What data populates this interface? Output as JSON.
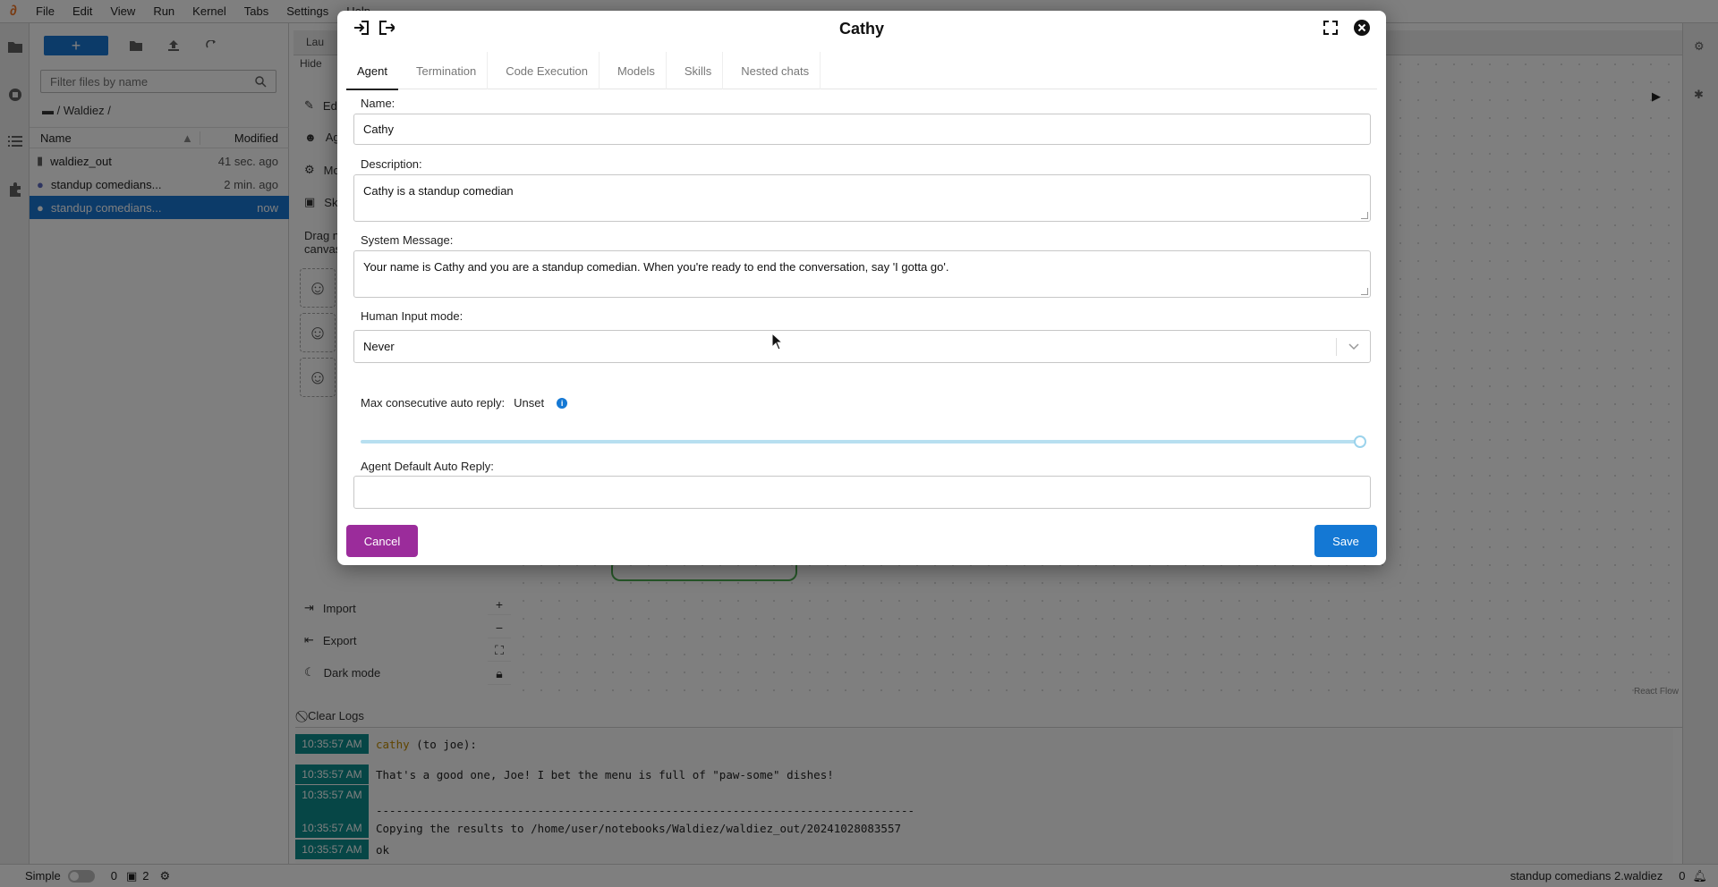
{
  "menubar": {
    "items": [
      "File",
      "Edit",
      "View",
      "Run",
      "Kernel",
      "Tabs",
      "Settings",
      "Help"
    ]
  },
  "filebrowser": {
    "filter_placeholder": "Filter files by name",
    "breadcrumb": "/ Waldiez /",
    "col_name": "Name",
    "col_modified": "Modified",
    "files": [
      {
        "name": "waldiez_out",
        "modified": "41 sec. ago"
      },
      {
        "name": "standup comedians...",
        "modified": "2 min. ago"
      },
      {
        "name": "standup comedians...",
        "modified": "now"
      }
    ]
  },
  "tabbar": {
    "tab1": "Lau",
    "tab2": "Hide"
  },
  "canvas_side": {
    "items": [
      "Ed",
      "Ag",
      "Mo",
      "Sk"
    ],
    "drag_hint_1": "Drag n",
    "drag_hint_2": "canvas",
    "import_label": "Import",
    "export_label": "Export",
    "darkmode_label": "Dark mode",
    "react_flow": "React Flow"
  },
  "logs": {
    "clear_label": "Clear Logs",
    "rows": [
      {
        "ts": "10:35:57 AM",
        "speaker": "cathy",
        "msg": " (to joe):"
      },
      {
        "ts": "10:35:57 AM",
        "speaker": "",
        "msg": "That's a good one, Joe! I bet the menu is full of \"paw-some\" dishes!"
      },
      {
        "ts": "10:35:57 AM",
        "speaker": "",
        "msg": ""
      },
      {
        "ts": "",
        "speaker": "",
        "msg": "--------------------------------------------------------------------------------"
      },
      {
        "ts": "10:35:57 AM",
        "speaker": "",
        "msg": "Copying the results to /home/user/notebooks/Waldiez/waldiez_out/20241028083557"
      },
      {
        "ts": "10:35:57 AM",
        "speaker": "",
        "msg": "ok"
      }
    ]
  },
  "statusbar": {
    "mode": "Simple",
    "count1": "0",
    "count2": "2",
    "filename": "standup comedians 2.waldiez",
    "notif": "0"
  },
  "modal": {
    "title": "Cathy",
    "tabs": [
      "Agent",
      "Termination",
      "Code Execution",
      "Models",
      "Skills",
      "Nested chats"
    ],
    "name_label": "Name:",
    "name_value": "Cathy",
    "description_label": "Description:",
    "description_value": "Cathy is a standup comedian",
    "system_label": "System Message:",
    "system_value": "Your name is Cathy and you are a standup comedian. When you're ready to end the conversation, say 'I gotta go'.",
    "human_input_label": "Human Input mode:",
    "human_input_value": "Never",
    "max_reply_label": "Max consecutive auto reply:",
    "max_reply_value": "Unset",
    "max_reply_slider_fraction": 1.0,
    "default_reply_label": "Agent Default Auto Reply:",
    "default_reply_value": "",
    "cancel_label": "Cancel",
    "save_label": "Save"
  },
  "colors": {
    "accent_blue": "#1976d2",
    "cancel_purple": "#9b2c9b",
    "log_teal": "#0d8d8d"
  }
}
